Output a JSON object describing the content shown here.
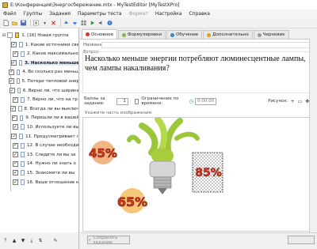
{
  "window": {
    "title": "E:\\Конференция\\Энергосбережение.mtx - MyTestEditor [MyTestXPro]"
  },
  "menu": [
    {
      "label": "Файл",
      "enabled": true
    },
    {
      "label": "Группы",
      "enabled": true
    },
    {
      "label": "Задания",
      "enabled": true
    },
    {
      "label": "Параметры теста",
      "enabled": true
    },
    {
      "label": "Формат",
      "enabled": false
    },
    {
      "label": "Настройка",
      "enabled": true
    },
    {
      "label": "Справка",
      "enabled": true
    }
  ],
  "tree": {
    "group": "1. [16] Новая группа",
    "items": [
      {
        "label": "1. Какие источники све",
        "checked": true,
        "selected": false
      },
      {
        "label": "2. Какое максимально",
        "checked": true,
        "selected": false
      },
      {
        "label": "3. Насколько меньше",
        "checked": true,
        "selected": true
      },
      {
        "label": "4. Во сколько раз меньш",
        "checked": true,
        "selected": false
      },
      {
        "label": "5. Потери тепловой энер",
        "checked": true,
        "selected": false
      },
      {
        "label": "6. Верно ли, что ширина",
        "checked": true,
        "selected": false
      },
      {
        "label": "7. Верно ли, что на тр",
        "checked": true,
        "selected": false
      },
      {
        "label": "8. Всегда ли вы выключ",
        "checked": true,
        "selected": false
      },
      {
        "label": "9. Перешли ли в вашей",
        "checked": true,
        "selected": false
      },
      {
        "label": "10. Используете ли вы",
        "checked": true,
        "selected": false
      },
      {
        "label": "11. Предусматривает л",
        "checked": true,
        "selected": false
      },
      {
        "label": "12. В случае необходи",
        "checked": true,
        "selected": false
      },
      {
        "label": "13. Следите ли вы за",
        "checked": true,
        "selected": false
      },
      {
        "label": "14. Нужно ли знать о",
        "checked": true,
        "selected": false
      },
      {
        "label": "15. Знакомите ли вы",
        "checked": true,
        "selected": false
      },
      {
        "label": "16. Ваше отношение к",
        "checked": true,
        "selected": false
      }
    ]
  },
  "tabs": [
    {
      "label": "Основное",
      "color": "#d9342b",
      "active": true
    },
    {
      "label": "Формулировки",
      "color": "#8ab24a",
      "active": false
    },
    {
      "label": "Обучение",
      "color": "#3a86c8",
      "active": false
    },
    {
      "label": "Дополнительно",
      "color": "#e0a020",
      "active": false
    },
    {
      "label": "Черновик",
      "color": "#999999",
      "active": false
    }
  ],
  "editor": {
    "name_label": "Название:",
    "question_label": "Вопрос:",
    "question_text": "Насколько меньше энергии потребляют люминесцентные лампы, чем лампы накаливания?",
    "score_label": "Баллы за задание:",
    "score_value": "1",
    "time_limit_label": "Ограничение по времени:",
    "time_value": "0:00:00",
    "picture_label": "Рисунок:",
    "hint": "Укажите часть изображения:"
  },
  "image_labels": [
    {
      "text": "45%",
      "fill": "#d43a1c"
    },
    {
      "text": "65%",
      "fill": "#d43a1c"
    },
    {
      "text": "85%",
      "fill": "#d43a1c"
    }
  ],
  "buttons": {
    "save": "Сохранить задание"
  }
}
